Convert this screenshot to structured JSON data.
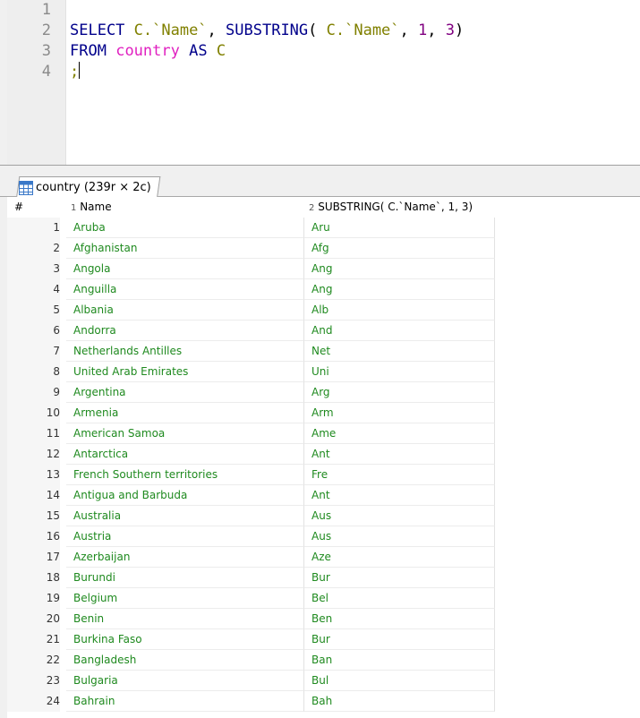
{
  "editor": {
    "line_numbers": [
      "1",
      "2",
      "3",
      "4"
    ],
    "line2": {
      "t1": "SELECT",
      "t2": " C.`Name`",
      "t3": ", ",
      "t4": "SUBSTRING",
      "t5": "( ",
      "t6": "C.`Name`",
      "t7": ", ",
      "t8": "1",
      "t9": ", ",
      "t10": "3",
      "t11": ")"
    },
    "line3": {
      "t1": "FROM",
      "t2": " ",
      "t3": "country",
      "t4": " ",
      "t5": "AS",
      "t6": " ",
      "t7": "C"
    },
    "line4": {
      "t1": ";"
    }
  },
  "result_tab": {
    "label": "country (239r × 2c)"
  },
  "grid": {
    "rownum_header": "#",
    "columns": [
      {
        "num": "1",
        "label": "Name"
      },
      {
        "num": "2",
        "label": "SUBSTRING( C.`Name`, 1, 3)"
      }
    ],
    "rows": [
      {
        "n": "1",
        "name": "Aruba",
        "sub": "Aru"
      },
      {
        "n": "2",
        "name": "Afghanistan",
        "sub": "Afg"
      },
      {
        "n": "3",
        "name": "Angola",
        "sub": "Ang"
      },
      {
        "n": "4",
        "name": "Anguilla",
        "sub": "Ang"
      },
      {
        "n": "5",
        "name": "Albania",
        "sub": "Alb"
      },
      {
        "n": "6",
        "name": "Andorra",
        "sub": "And"
      },
      {
        "n": "7",
        "name": "Netherlands Antilles",
        "sub": "Net"
      },
      {
        "n": "8",
        "name": "United Arab Emirates",
        "sub": "Uni"
      },
      {
        "n": "9",
        "name": "Argentina",
        "sub": "Arg"
      },
      {
        "n": "10",
        "name": "Armenia",
        "sub": "Arm"
      },
      {
        "n": "11",
        "name": "American Samoa",
        "sub": "Ame"
      },
      {
        "n": "12",
        "name": "Antarctica",
        "sub": "Ant"
      },
      {
        "n": "13",
        "name": "French Southern territories",
        "sub": "Fre"
      },
      {
        "n": "14",
        "name": "Antigua and Barbuda",
        "sub": "Ant"
      },
      {
        "n": "15",
        "name": "Australia",
        "sub": "Aus"
      },
      {
        "n": "16",
        "name": "Austria",
        "sub": "Aus"
      },
      {
        "n": "17",
        "name": "Azerbaijan",
        "sub": "Aze"
      },
      {
        "n": "18",
        "name": "Burundi",
        "sub": "Bur"
      },
      {
        "n": "19",
        "name": "Belgium",
        "sub": "Bel"
      },
      {
        "n": "20",
        "name": "Benin",
        "sub": "Ben"
      },
      {
        "n": "21",
        "name": "Burkina Faso",
        "sub": "Bur"
      },
      {
        "n": "22",
        "name": "Bangladesh",
        "sub": "Ban"
      },
      {
        "n": "23",
        "name": "Bulgaria",
        "sub": "Bul"
      },
      {
        "n": "24",
        "name": "Bahrain",
        "sub": "Bah"
      }
    ]
  },
  "colors": {
    "keyword": "#00008b",
    "identifier": "#808000",
    "table_name": "#e020c0",
    "number": "#800080",
    "cell_text": "#1f8a1f"
  },
  "icons": {
    "tab_icon": "table-grid-icon"
  }
}
